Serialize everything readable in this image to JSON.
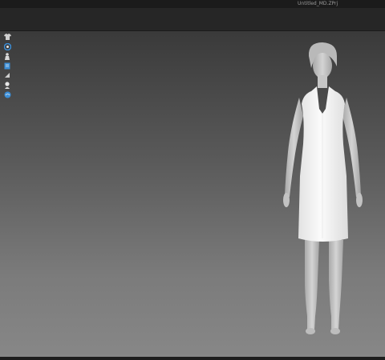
{
  "window": {
    "title": "Untitled_MD.ZPrj"
  },
  "viewport_tools": [
    {
      "icon": "garment-icon",
      "color": "#cfcfcf"
    },
    {
      "icon": "arrangement-icon",
      "color": "#3b8fd9"
    },
    {
      "icon": "avatar-icon",
      "color": "#d8d8d8"
    },
    {
      "icon": "pattern-icon",
      "color": "#3b8fd9"
    },
    {
      "icon": "tape-icon",
      "color": "#cfcfcf"
    },
    {
      "icon": "user-icon",
      "color": "#e8e8e8"
    },
    {
      "icon": "texture-icon",
      "color": "#3b8fd9"
    }
  ],
  "colors": {
    "background_top": "#3a3a3a",
    "background_bottom": "#878787",
    "avatar": "#c8c8c8",
    "dress": "#f4f4f4"
  }
}
